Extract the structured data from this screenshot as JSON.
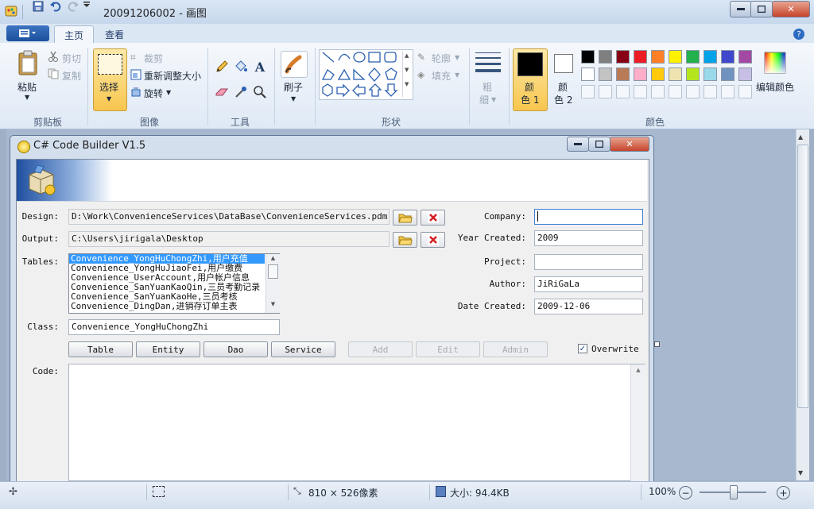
{
  "window": {
    "title": "20091206002 - 画图"
  },
  "ribbon": {
    "tabs": [
      {
        "label": "主页",
        "active": true
      },
      {
        "label": "查看",
        "active": false
      }
    ],
    "clipboard": {
      "group": "剪贴板",
      "paste": "粘贴",
      "cut": "剪切",
      "copy": "复制"
    },
    "image": {
      "group": "图像",
      "select": "选择",
      "crop": "裁剪",
      "resize": "重新调整大小",
      "rotate": "旋转"
    },
    "tools": {
      "group": "工具"
    },
    "brushes": {
      "label": "刷子"
    },
    "shapes": {
      "group": "形状",
      "outline": "轮廓",
      "fill": "填充"
    },
    "size": {
      "label_line1": "粗",
      "label_line2": "细"
    },
    "colors": {
      "group": "颜色",
      "color1_line1": "颜",
      "color1_line2": "色 1",
      "color2_line1": "颜",
      "color2_line2": "色 2",
      "edit": "编辑颜色",
      "color1": "#000000",
      "color2": "#ffffff",
      "palette_row1": [
        "#000000",
        "#7f7f7f",
        "#880015",
        "#ed1c24",
        "#ff7f27",
        "#fff200",
        "#22b14c",
        "#00a2e8",
        "#3f48cc",
        "#a349a4"
      ],
      "palette_row2": [
        "#ffffff",
        "#c3c3c3",
        "#b97a57",
        "#ffaec9",
        "#ffc90e",
        "#efe4b0",
        "#b5e61d",
        "#99d9ea",
        "#7092be",
        "#c8bfe7"
      ]
    }
  },
  "dialog": {
    "title": "C# Code Builder V1.5",
    "design": {
      "label": "Design:",
      "value": "D:\\Work\\ConvenienceServices\\DataBase\\ConvenienceServices.pdm"
    },
    "output": {
      "label": "Output:",
      "value": "C:\\Users\\jirigala\\Desktop"
    },
    "tables": {
      "label": "Tables:",
      "items": [
        "Convenience_YongHuChongZhi,用户充值",
        "Convenience_YongHuJiaoFei,用户缴费",
        "Convenience_UserAccount,用户帐户信息",
        "Convenience_SanYuanKaoQin,三员考勤记录",
        "Convenience_SanYuanKaoHe,三员考核",
        "Convenience_DingDan,进销存订单主表"
      ]
    },
    "class": {
      "label": "Class:",
      "value": "Convenience_YongHuChongZhi"
    },
    "company": {
      "label": "Company:",
      "value": ""
    },
    "year_created": {
      "label": "Year Created:",
      "value": "2009"
    },
    "project": {
      "label": "Project:",
      "value": ""
    },
    "author": {
      "label": "Author:",
      "value": "JiRiGaLa"
    },
    "date_created": {
      "label": "Date Created:",
      "value": "2009-12-06"
    },
    "buttons": {
      "table": "Table",
      "entity": "Entity",
      "dao": "Dao",
      "service": "Service",
      "add": "Add",
      "edit": "Edit",
      "admin": "Admin"
    },
    "overwrite": {
      "label": "Overwrite",
      "checked": true
    },
    "code": {
      "label": "Code:",
      "value": ""
    }
  },
  "statusbar": {
    "dimensions": "810 × 526像素",
    "size": "大小: 94.4KB",
    "zoom": "100%"
  }
}
